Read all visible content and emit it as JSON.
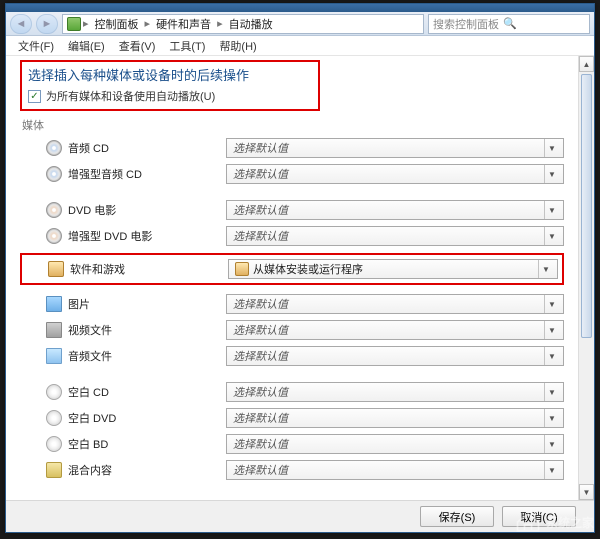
{
  "nav": {
    "crumb1": "控制面板",
    "crumb2": "硬件和声音",
    "crumb3": "自动播放",
    "search_placeholder": "搜索控制面板"
  },
  "menu": {
    "file": "文件(F)",
    "edit": "编辑(E)",
    "view": "查看(V)",
    "tools": "工具(T)",
    "help": "帮助(H)"
  },
  "header": {
    "title": "选择插入每种媒体或设备时的后续操作",
    "checkbox_label": "为所有媒体和设备使用自动播放(U)",
    "checked": true
  },
  "section_media": "媒体",
  "default_choice": "选择默认值",
  "rows": {
    "audio_cd": "音频 CD",
    "enh_audio_cd": "增强型音频 CD",
    "dvd_movie": "DVD 电影",
    "enh_dvd_movie": "增强型 DVD 电影",
    "software": "软件和游戏",
    "software_value": "从媒体安装或运行程序",
    "pictures": "图片",
    "videos": "视频文件",
    "audio_files": "音频文件",
    "blank_cd": "空白 CD",
    "blank_dvd": "空白 DVD",
    "blank_bd": "空白 BD",
    "mixed": "混合内容"
  },
  "buttons": {
    "save": "保存(S)",
    "cancel": "取消(C)"
  },
  "watermark": "系统之家"
}
